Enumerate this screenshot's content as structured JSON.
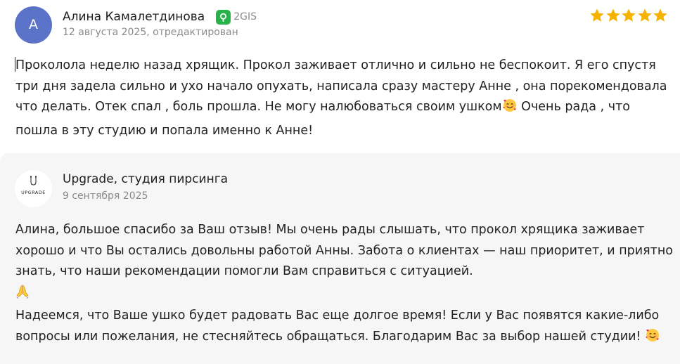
{
  "review": {
    "avatar_letter": "А",
    "avatar_color": "#5a72c8",
    "author": "Алина Камалетдинова",
    "source_icon": "2gis-icon",
    "source_label": "2GIS",
    "date": "12 августа 2025, отредактирован",
    "rating": 5,
    "rating_max": 5,
    "text_before_emoji": "Проколола неделю назад хрящик. Прокол заживает отлично и сильно не беспокоит. Я его спустя три дня задела сильно и ухо начало опухать, написала сразу мастеру Анне , она порекомендовала что делать. Отек спал , боль прошла. Не могу налюбоваться своим ушком",
    "emoji_1": "smiling-face-with-hearts-emoji",
    "text_after_emoji": " Очень рада , что пошла в эту студию и попала именно к Анне!"
  },
  "reply": {
    "logo_text": "UPGRADE",
    "author": "Upgrade, студия пирсинга",
    "date": "9 сентября 2025",
    "paragraph_1": "Алина, большое спасибо за Ваш отзыв! Мы очень рады слышать, что прокол хрящика заживает хорошо и что Вы остались довольны работой Анны. Забота о клиентах — наш приоритет, и приятно знать, что наши рекомендации помогли Вам справиться с ситуацией.",
    "emoji_1": "folded-hands-emoji",
    "paragraph_2": "Надеемся, что Ваше ушко будет радовать Вас еще долгое время! Если у Вас появятся какие-либо вопросы или пожелания, не стесняйтесь обращаться. Благодарим Вас за выбор нашей студии! ",
    "emoji_2": "smiling-face-with-hearts-emoji"
  },
  "colors": {
    "star": "#f5b300",
    "source_green": "#29b24b",
    "reply_background": "#f6f6f6"
  }
}
